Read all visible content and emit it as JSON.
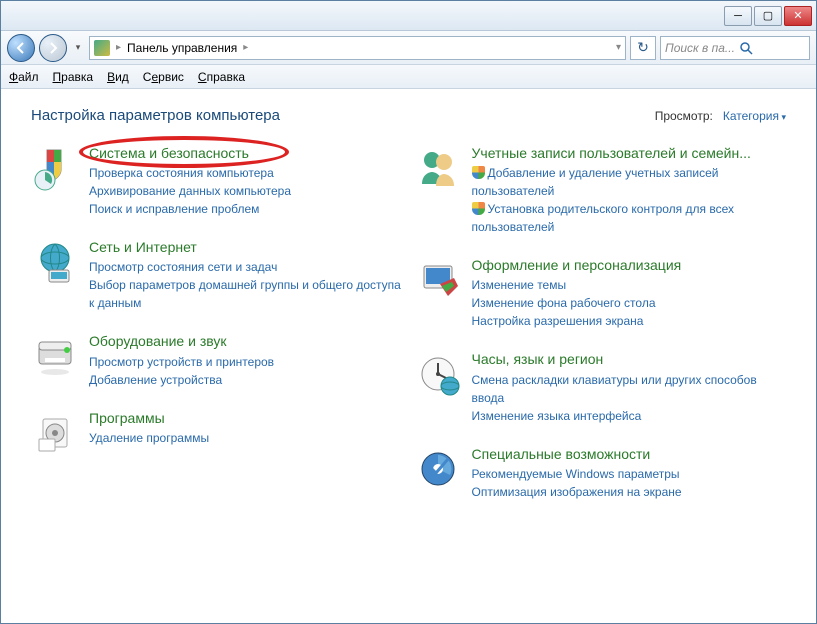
{
  "breadcrumb": {
    "root": "Панель управления"
  },
  "search": {
    "placeholder": "Поиск в па..."
  },
  "menu": {
    "file": "Файл",
    "edit": "Правка",
    "view": "Вид",
    "tools": "Сервис",
    "help": "Справка"
  },
  "heading": "Настройка параметров компьютера",
  "viewby": {
    "label": "Просмотр:",
    "value": "Категория"
  },
  "left": [
    {
      "title": "Система и безопасность",
      "links": [
        {
          "t": "Проверка состояния компьютера"
        },
        {
          "t": "Архивирование данных компьютера"
        },
        {
          "t": "Поиск и исправление проблем"
        }
      ]
    },
    {
      "title": "Сеть и Интернет",
      "links": [
        {
          "t": "Просмотр состояния сети и задач"
        },
        {
          "t": "Выбор параметров домашней группы и общего доступа к данным"
        }
      ]
    },
    {
      "title": "Оборудование и звук",
      "links": [
        {
          "t": "Просмотр устройств и принтеров"
        },
        {
          "t": "Добавление устройства"
        }
      ]
    },
    {
      "title": "Программы",
      "links": [
        {
          "t": "Удаление программы"
        }
      ]
    }
  ],
  "right": [
    {
      "title": "Учетные записи пользователей и семейн...",
      "links": [
        {
          "t": "Добавление и удаление учетных записей пользователей",
          "shield": true
        },
        {
          "t": "Установка родительского контроля для всех пользователей",
          "shield": true
        }
      ]
    },
    {
      "title": "Оформление и персонализация",
      "links": [
        {
          "t": "Изменение темы"
        },
        {
          "t": "Изменение фона рабочего стола"
        },
        {
          "t": "Настройка разрешения экрана"
        }
      ]
    },
    {
      "title": "Часы, язык и регион",
      "links": [
        {
          "t": "Смена раскладки клавиатуры или других способов ввода"
        },
        {
          "t": "Изменение языка интерфейса"
        }
      ]
    },
    {
      "title": "Специальные возможности",
      "links": [
        {
          "t": "Рекомендуемые Windows параметры"
        },
        {
          "t": "Оптимизация изображения на экране"
        }
      ]
    }
  ]
}
